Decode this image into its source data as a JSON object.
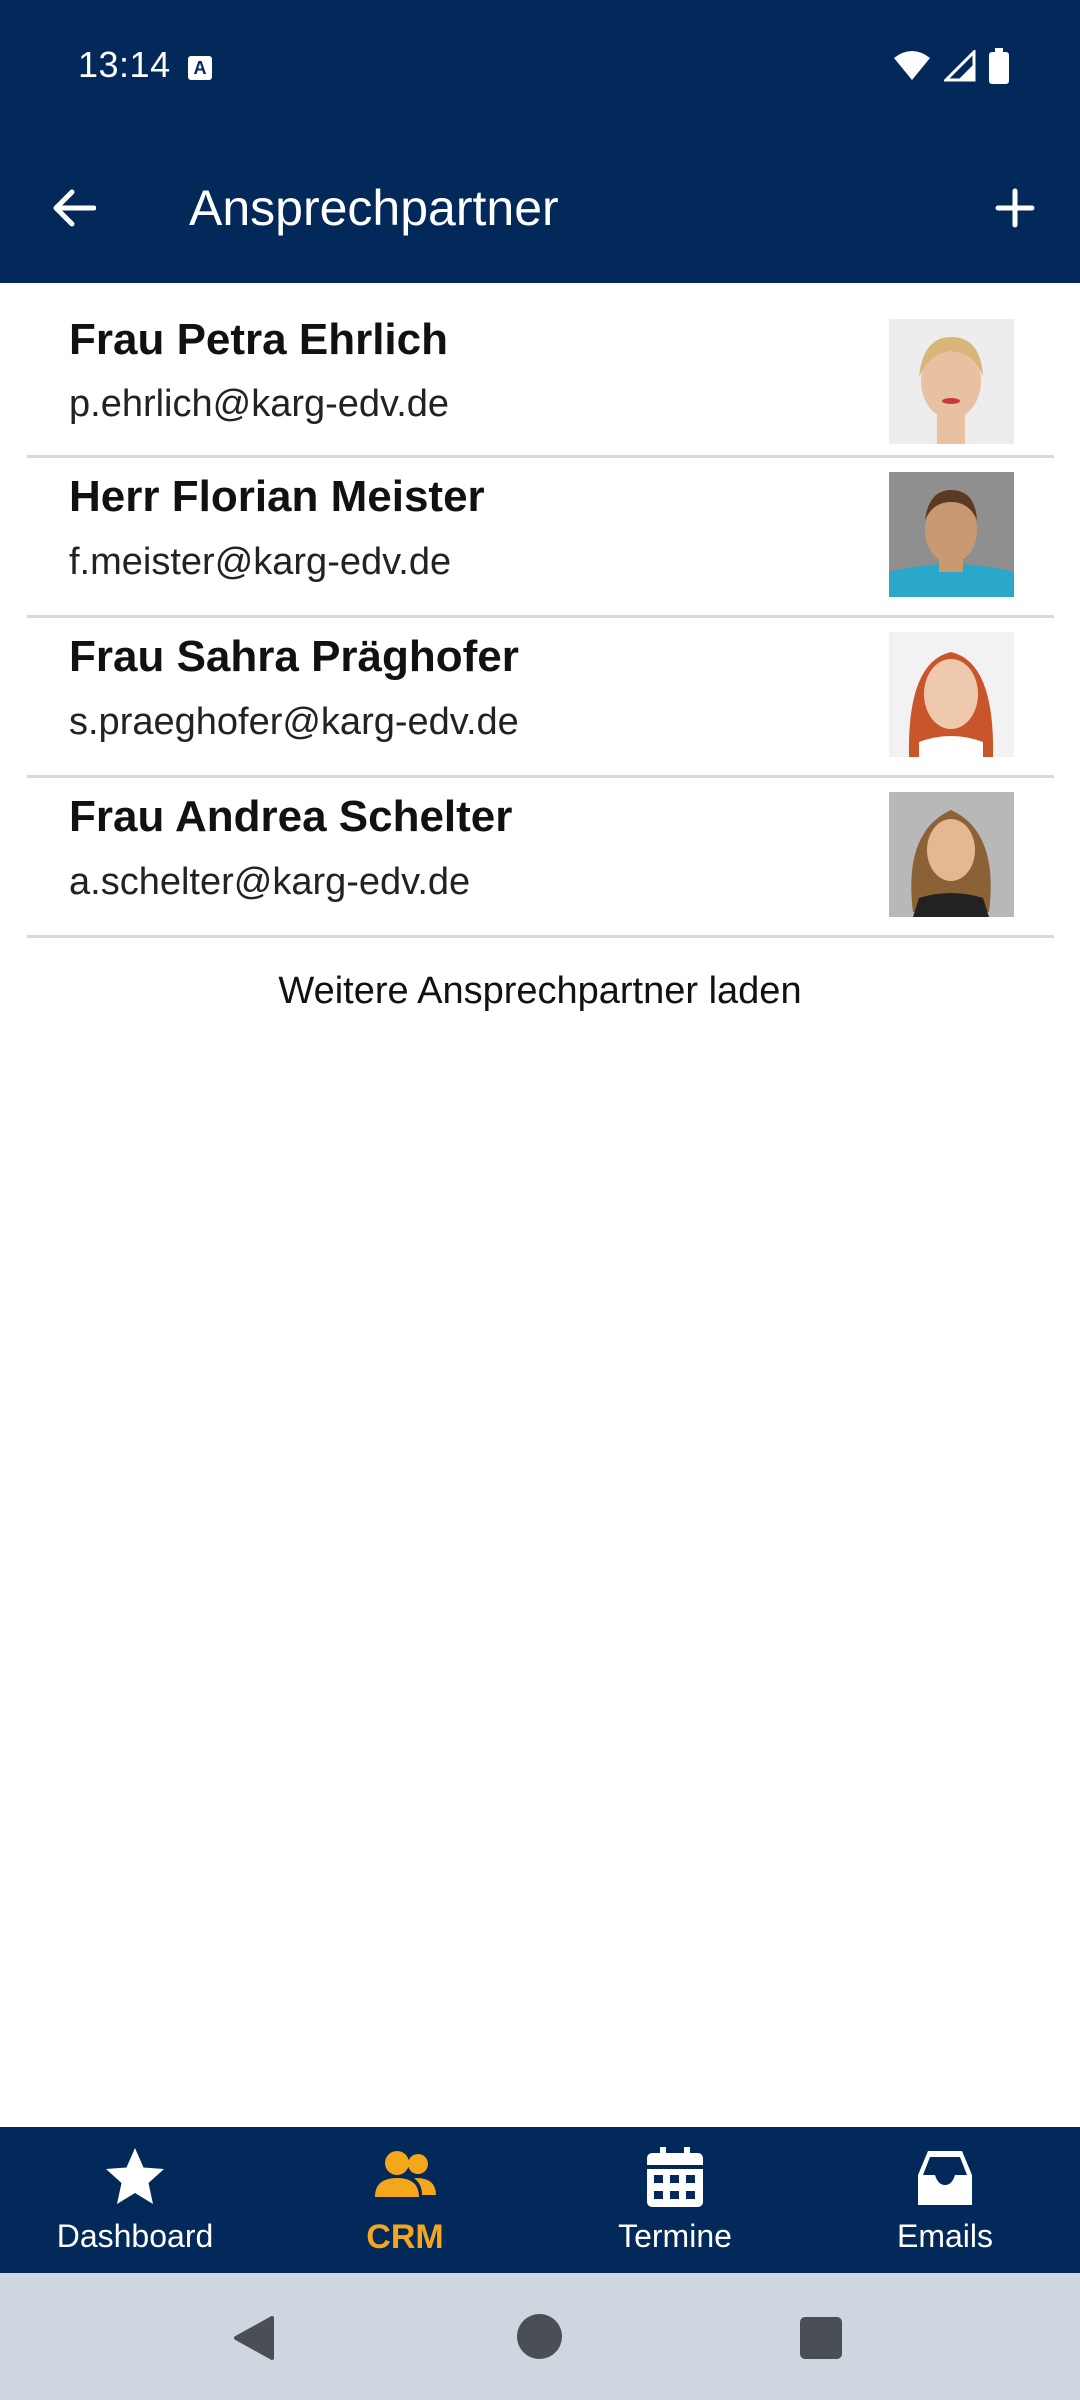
{
  "status": {
    "time": "13:14"
  },
  "header": {
    "title": "Ansprechpartner"
  },
  "contacts": [
    {
      "name": "Frau Petra Ehrlich",
      "email": "p.ehrlich@karg-edv.de"
    },
    {
      "name": "Herr Florian Meister",
      "email": "f.meister@karg-edv.de"
    },
    {
      "name": "Frau Sahra Präghofer",
      "email": "s.praeghofer@karg-edv.de"
    },
    {
      "name": "Frau Andrea Schelter",
      "email": "a.schelter@karg-edv.de"
    }
  ],
  "load_more": "Weitere Ansprechpartner laden",
  "nav": {
    "items": [
      {
        "label": "Dashboard",
        "icon": "star-icon"
      },
      {
        "label": "CRM",
        "icon": "people-icon"
      },
      {
        "label": "Termine",
        "icon": "calendar-icon"
      },
      {
        "label": "Emails",
        "icon": "inbox-icon"
      }
    ],
    "active": "CRM"
  },
  "colors": {
    "primary": "#02295a",
    "accent": "#f5a71c",
    "system_nav": "#cfd6df"
  }
}
